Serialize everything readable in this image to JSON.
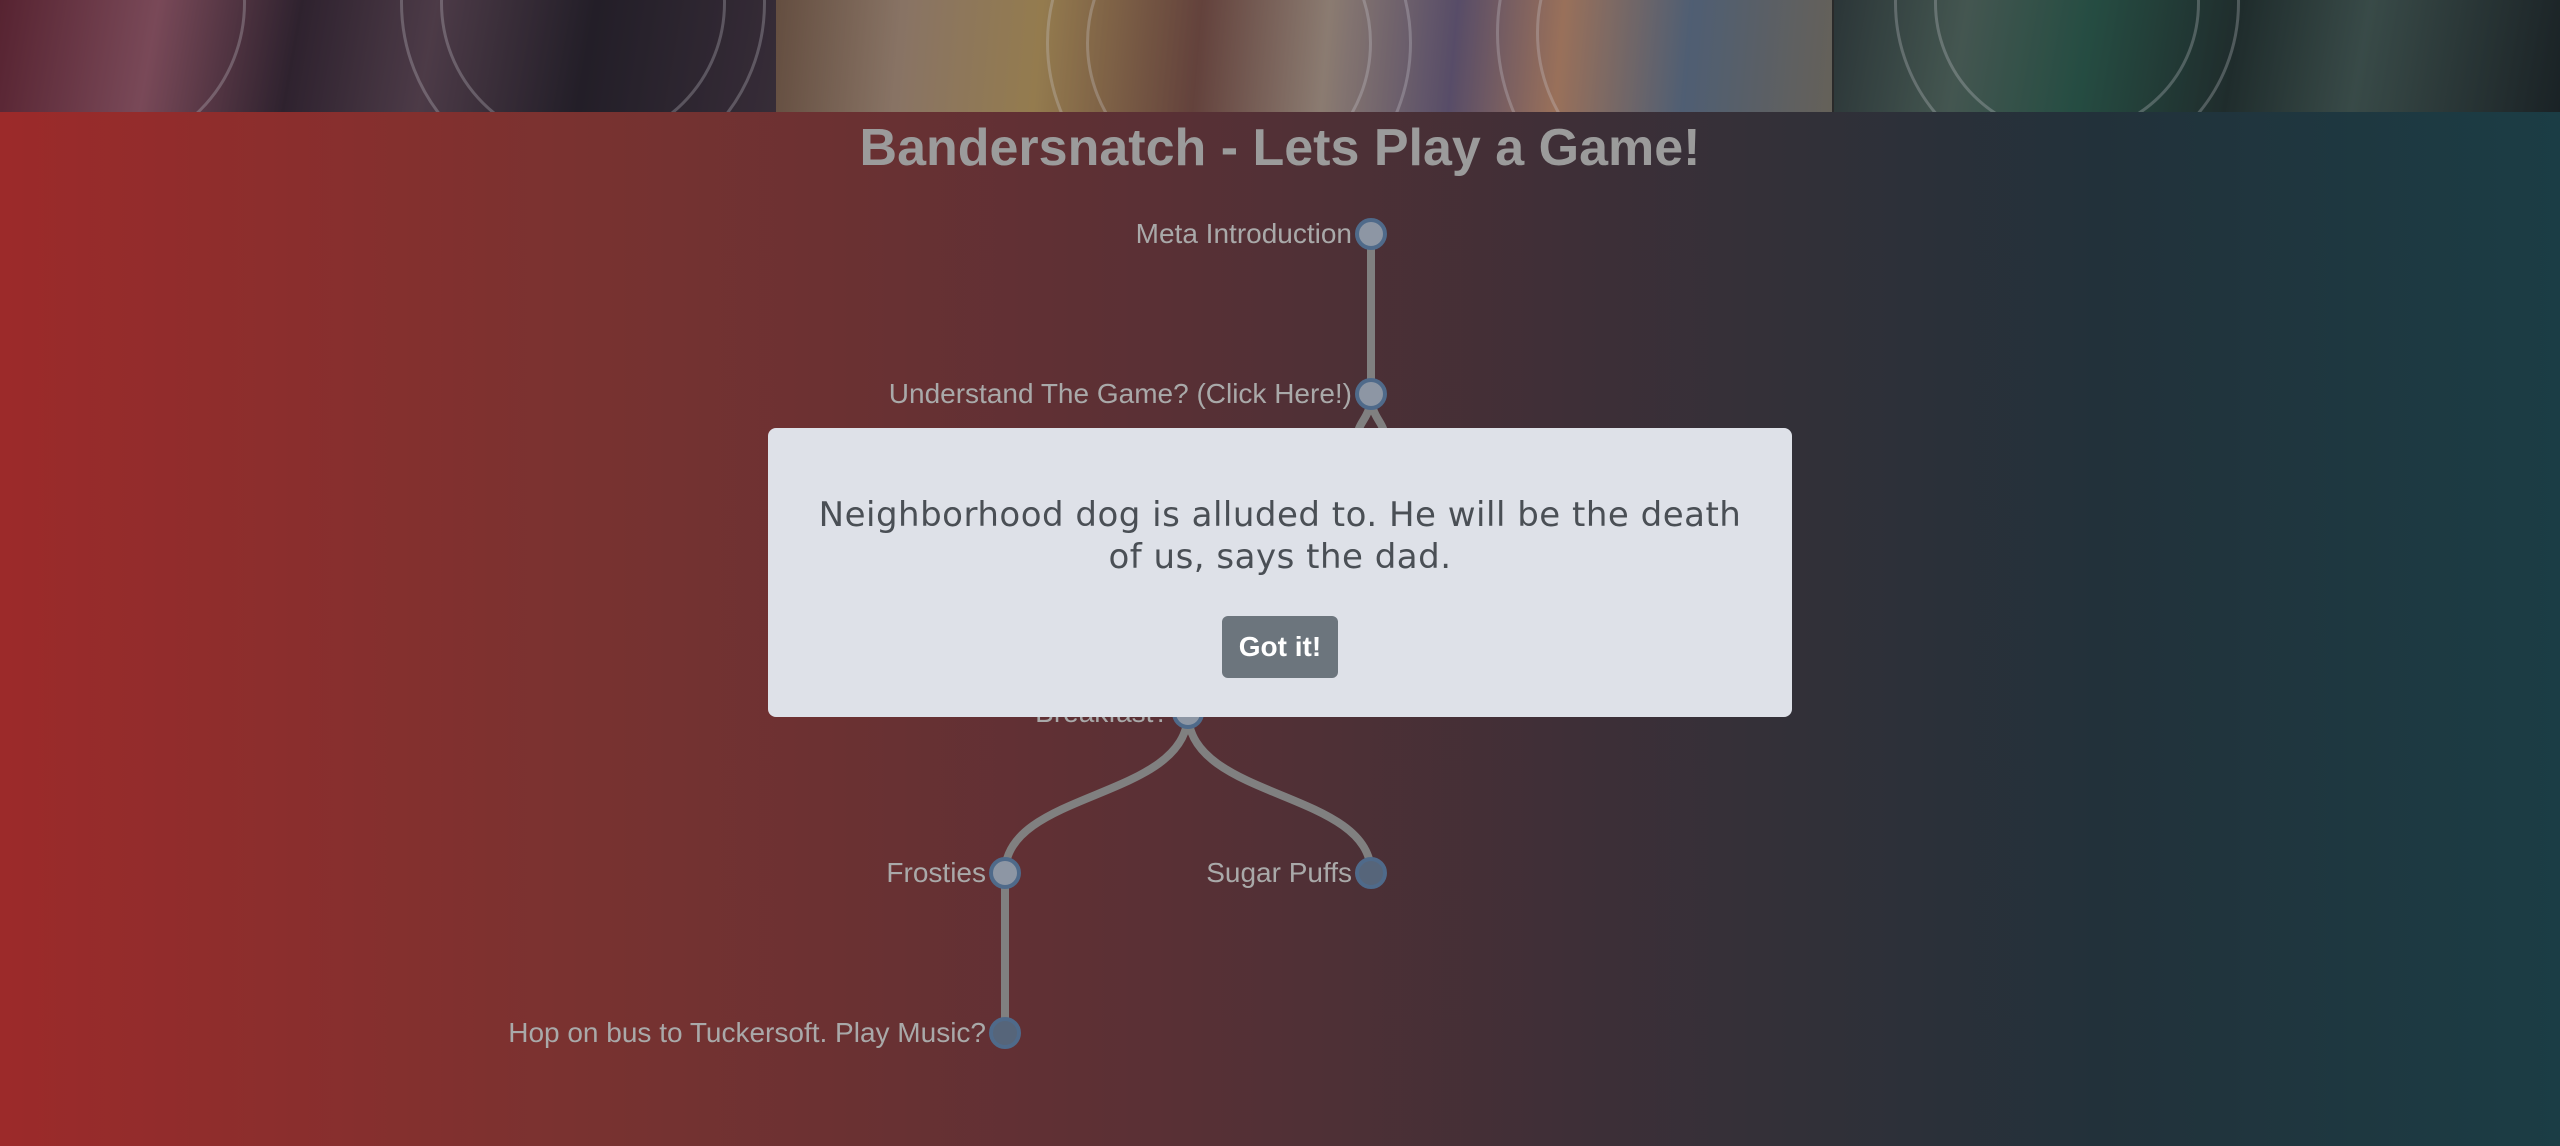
{
  "page": {
    "title": "Bandersnatch - Lets Play a Game!"
  },
  "tree": {
    "nodes": [
      {
        "id": "meta-introduction",
        "label": "Meta Introduction"
      },
      {
        "id": "understand-the-game",
        "label": "Understand The Game? (Click Here!)"
      },
      {
        "id": "breakfast",
        "label": "Breakfast?"
      },
      {
        "id": "frosties",
        "label": "Frosties"
      },
      {
        "id": "sugar-puffs",
        "label": "Sugar Puffs"
      },
      {
        "id": "hop-on-bus",
        "label": "Hop on bus to Tuckersoft. Play Music?"
      }
    ]
  },
  "modal": {
    "message": "Neighborhood dog is alluded to. He will be the death of us, says the dad.",
    "button_label": "Got it!"
  },
  "colors": {
    "node_fill": "#8d96a4",
    "node_stroke": "#4f6a8a",
    "link": "#808080",
    "button": "#6c757d",
    "modal_bg": "#dee1e8"
  }
}
